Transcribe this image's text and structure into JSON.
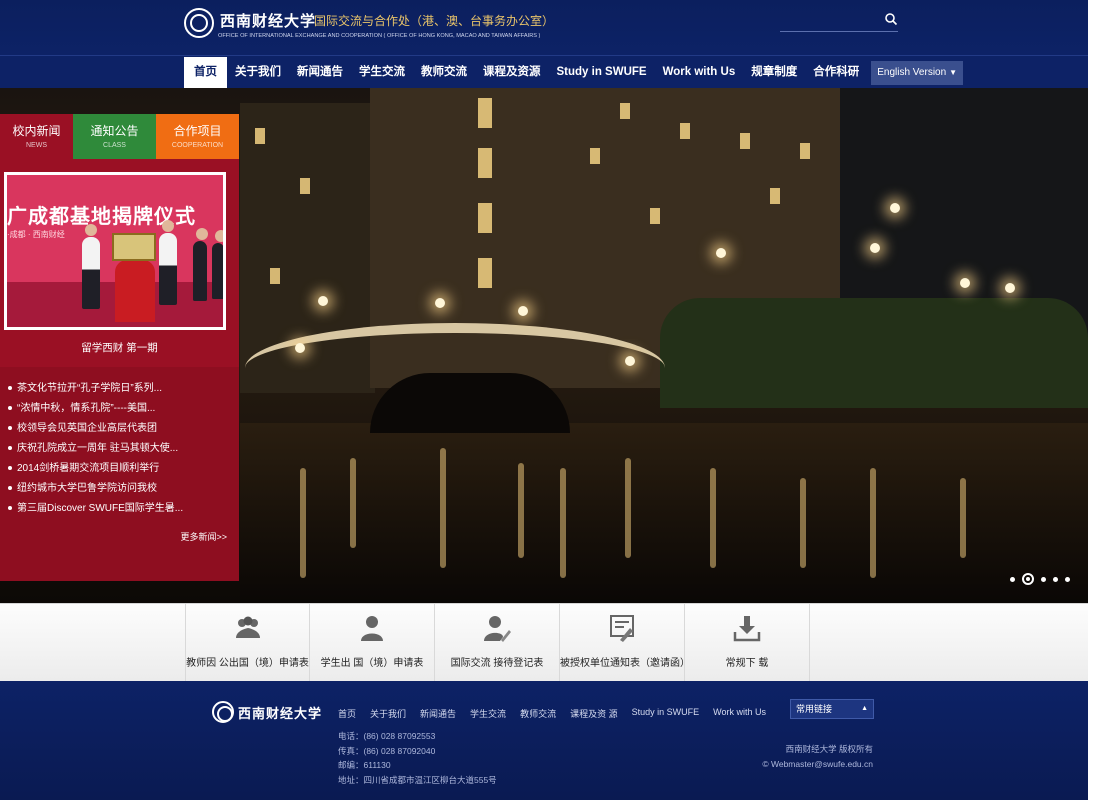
{
  "header": {
    "logo_cn": "西南财经大学",
    "dept_cn": "国际交流与合作处（港、澳、台事务办公室）",
    "dept_en": "OFFICE OF INTERNATIONAL EXCHANGE AND COOPERATION ( OFFICE OF HONG KONG, MACAO AND TAIWAN AFFAIRS )",
    "search_placeholder": ""
  },
  "nav": {
    "items": [
      "首页",
      "关于我们",
      "新闻通告",
      "学生交流",
      "教师交流",
      "课程及资源",
      "Study in SWUFE",
      "Work with Us",
      "规章制度",
      "合作科研"
    ],
    "lang": "English Version"
  },
  "panel": {
    "tabs": [
      {
        "cn": "校内新闻",
        "en": "NEWS"
      },
      {
        "cn": "通知公告",
        "en": "CLASS"
      },
      {
        "cn": "合作项目",
        "en": "COOPERATION"
      }
    ],
    "feature_banner": "广成都基地揭牌仪式",
    "feature_sub": "·成都 · 西南财经",
    "feature_caption": "留学西财 第一期",
    "news": [
      "茶文化节拉开“孔子学院日”系列...",
      "“浓情中秋，情系孔院”----美国...",
      "校领导会见英国企业高层代表团",
      "庆祝孔院成立一周年 驻马其顿大使...",
      "2014剑桥暑期交流项目顺利举行",
      "纽约城市大学巴鲁学院访问我校",
      "第三届Discover SWUFE国际学生暑..."
    ],
    "more": "更多新闻>>"
  },
  "slider": {
    "count": 5,
    "active_index": 1
  },
  "quick_links": [
    {
      "label": "教师因 公出国（境）申请表",
      "icon": "group-icon"
    },
    {
      "label": "学生出 国（境）申请表",
      "icon": "person-icon"
    },
    {
      "label": "国际交流 接待登记表",
      "icon": "person-edit-icon"
    },
    {
      "label": "被授权单位通知表（邀请函）",
      "icon": "document-edit-icon"
    },
    {
      "label": "常规下 载",
      "icon": "download-icon"
    }
  ],
  "footer": {
    "name": "西南财经大学",
    "nav": [
      "首页",
      "关于我们",
      "新闻通告",
      "学生交流",
      "教师交流",
      "课程及资 源",
      "Study in SWUFE",
      "Work with Us"
    ],
    "phone": "电话：(86) 028 87092553",
    "fax": "传真：(86) 028 87092040",
    "postcode": "邮编：611130",
    "address": "地址：四川省成都市温江区柳台大道555号",
    "links_select": "常用链接",
    "copyright": "西南财经大学 版权所有",
    "webmaster": "© Webmaster@swufe.edu.cn"
  }
}
